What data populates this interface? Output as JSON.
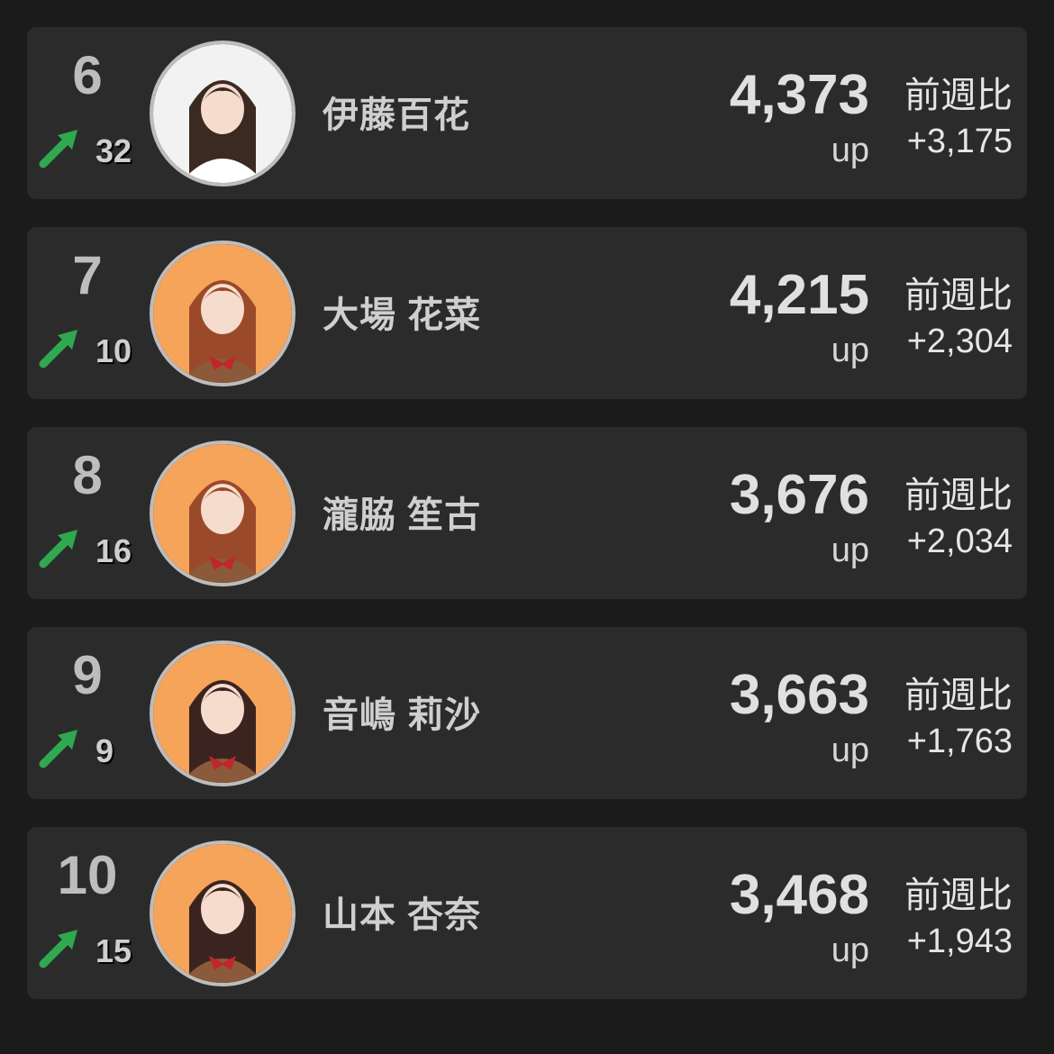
{
  "colors": {
    "background": "#1b1b1b",
    "card": "#2b2b2b",
    "arrow_up": "#2fa84f",
    "text": "#e0e0e0"
  },
  "rankings": [
    {
      "rank": "6",
      "movement": "32",
      "name": "伊藤百花",
      "score": "4,373",
      "up_label": "up",
      "wow_label": "前週比",
      "wow_value": "+3,175",
      "avatar_bg": "#f2f2f2"
    },
    {
      "rank": "7",
      "movement": "10",
      "name": "大場 花菜",
      "score": "4,215",
      "up_label": "up",
      "wow_label": "前週比",
      "wow_value": "+2,304",
      "avatar_bg": "#f6a45a"
    },
    {
      "rank": "8",
      "movement": "16",
      "name": "瀧脇 笙古",
      "score": "3,676",
      "up_label": "up",
      "wow_label": "前週比",
      "wow_value": "+2,034",
      "avatar_bg": "#f6a45a"
    },
    {
      "rank": "9",
      "movement": "9",
      "name": "音嶋 莉沙",
      "score": "3,663",
      "up_label": "up",
      "wow_label": "前週比",
      "wow_value": "+1,763",
      "avatar_bg": "#f6a45a"
    },
    {
      "rank": "10",
      "movement": "15",
      "name": "山本 杏奈",
      "score": "3,468",
      "up_label": "up",
      "wow_label": "前週比",
      "wow_value": "+1,943",
      "avatar_bg": "#f6a45a"
    }
  ]
}
